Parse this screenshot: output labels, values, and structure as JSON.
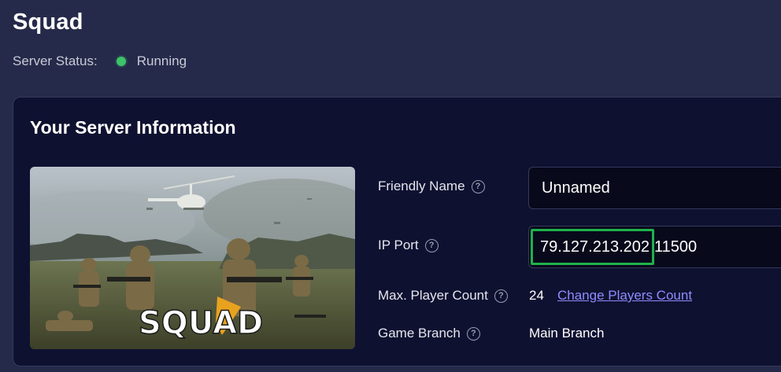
{
  "header": {
    "title": "Squad",
    "status_label": "Server Status:",
    "status_value": "Running",
    "status_color": "#3cc46a"
  },
  "card": {
    "title": "Your Server Information",
    "image_alt": "Squad game artwork",
    "logo_text": "SQUAD",
    "fields": {
      "friendly_name": {
        "label": "Friendly Name",
        "value": "Unnamed"
      },
      "ip_port": {
        "label": "IP Port",
        "ip": "79.127.213.202",
        "port": "11500"
      },
      "max_players": {
        "label": "Max. Player Count",
        "value": "24",
        "link": "Change Players Count"
      },
      "game_branch": {
        "label": "Game Branch",
        "value": "Main Branch"
      }
    },
    "help_icon": "question-circle-icon"
  },
  "colors": {
    "background": "#262a4a",
    "card": "#0f1130",
    "link": "#8e8cff",
    "highlight": "#1fb14a"
  }
}
